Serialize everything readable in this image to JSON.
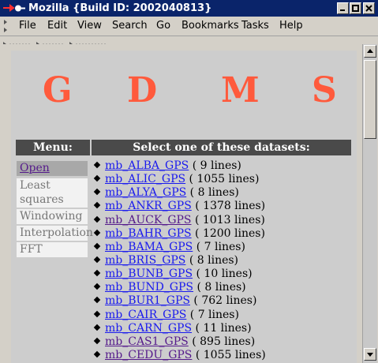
{
  "window": {
    "title": "Mozilla {Build ID: 2002040813}"
  },
  "menubar": {
    "items": [
      "File",
      "Edit",
      "View",
      "Search",
      "Go",
      "Bookmarks",
      "Tasks",
      "Help"
    ]
  },
  "page": {
    "letters": [
      "G",
      "D",
      "M",
      "S"
    ],
    "menu_header": "Menu:",
    "datasets_header": "Select one of these datasets:",
    "side_menu": [
      {
        "label": "Open"
      },
      {
        "label": "Least squares"
      },
      {
        "label": "Windowing"
      },
      {
        "label": "Interpolation"
      },
      {
        "label": "FFT"
      }
    ],
    "datasets": [
      {
        "name": "mb_ALBA_GPS",
        "count": "( 9 lines)"
      },
      {
        "name": "mb_ALIC_GPS",
        "count": "( 1055 lines)"
      },
      {
        "name": "mb_ALYA_GPS",
        "count": "( 8 lines)"
      },
      {
        "name": "mb_ANKR_GPS",
        "count": "( 1378 lines)"
      },
      {
        "name": "mb_AUCK_GPS",
        "count": "( 1013 lines)"
      },
      {
        "name": "mb_BAHR_GPS",
        "count": "( 1200 lines)"
      },
      {
        "name": "mb_BAMA_GPS",
        "count": "( 7 lines)"
      },
      {
        "name": "mb_BRIS_GPS",
        "count": "( 8 lines)"
      },
      {
        "name": "mb_BUNB_GPS",
        "count": "( 10 lines)"
      },
      {
        "name": "mb_BUND_GPS",
        "count": "( 8 lines)"
      },
      {
        "name": "mb_BUR1_GPS",
        "count": "( 762 lines)"
      },
      {
        "name": "mb_CAIR_GPS",
        "count": "( 7 lines)"
      },
      {
        "name": "mb_CARN_GPS",
        "count": "( 11 lines)"
      },
      {
        "name": "mb_CAS1_GPS",
        "count": "( 895 lines)"
      },
      {
        "name": "mb_CEDU_GPS",
        "count": "( 1055 lines)"
      }
    ]
  },
  "colors": {
    "title_bar": "#0a246a",
    "accent_letters": "#ff5a3c",
    "link": "#1a1aee",
    "visited_link": "#551a8b",
    "header_bar": "#4a4a4a"
  }
}
